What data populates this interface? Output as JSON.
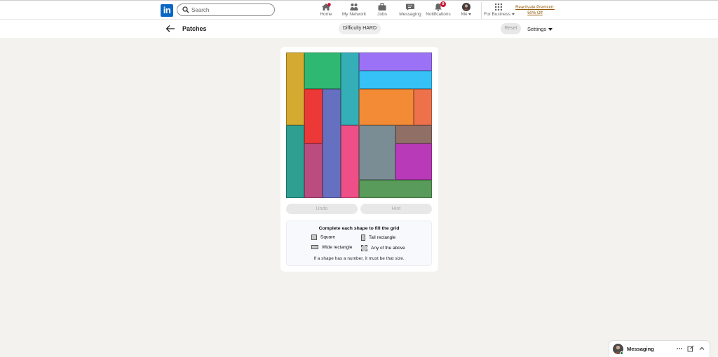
{
  "nav": {
    "logo": "in",
    "search_placeholder": "Search",
    "items": [
      {
        "label": "Home",
        "icon": "home-icon"
      },
      {
        "label": "My Network",
        "icon": "network-icon"
      },
      {
        "label": "Jobs",
        "icon": "jobs-icon"
      },
      {
        "label": "Messaging",
        "icon": "messaging-icon"
      },
      {
        "label": "Notifications",
        "icon": "bell-icon",
        "badge": "8"
      },
      {
        "label": "Me",
        "icon": "avatar"
      },
      {
        "label": "For Business",
        "icon": "grid-icon"
      }
    ],
    "premium_line1": "Reactivate Premium:",
    "premium_line2": "50% Off"
  },
  "game": {
    "title": "Patches",
    "difficulty": "Difficulty HARD",
    "reset": "Reset",
    "settings": "Settings",
    "undo": "Undo",
    "hint": "Hint",
    "grid_size": 8,
    "patches": [
      {
        "name": "patch-mustard",
        "col": 0,
        "row": 0,
        "w": 1,
        "h": 4,
        "color": "#d4aa30"
      },
      {
        "name": "patch-green",
        "col": 1,
        "row": 0,
        "w": 2,
        "h": 2,
        "color": "#2fb872"
      },
      {
        "name": "patch-teal-top",
        "col": 3,
        "row": 0,
        "w": 1,
        "h": 4,
        "color": "#34afb8"
      },
      {
        "name": "patch-purple",
        "col": 4,
        "row": 0,
        "w": 4,
        "h": 1,
        "color": "#9b72f6"
      },
      {
        "name": "patch-sky",
        "col": 4,
        "row": 1,
        "w": 4,
        "h": 1,
        "color": "#36c1f7"
      },
      {
        "name": "patch-red",
        "col": 1,
        "row": 2,
        "w": 1,
        "h": 3,
        "color": "#ed3838"
      },
      {
        "name": "patch-indigo",
        "col": 2,
        "row": 2,
        "w": 1,
        "h": 6,
        "color": "#6570c0"
      },
      {
        "name": "patch-orange",
        "col": 4,
        "row": 2,
        "w": 3,
        "h": 2,
        "color": "#f28a36"
      },
      {
        "name": "patch-coral",
        "col": 7,
        "row": 2,
        "w": 1,
        "h": 2,
        "color": "#ed724c"
      },
      {
        "name": "patch-teal-left",
        "col": 0,
        "row": 4,
        "w": 1,
        "h": 4,
        "color": "#2e9f91"
      },
      {
        "name": "patch-pink",
        "col": 3,
        "row": 4,
        "w": 1,
        "h": 4,
        "color": "#ef4f87"
      },
      {
        "name": "patch-slate",
        "col": 4,
        "row": 4,
        "w": 2,
        "h": 3,
        "color": "#7a8c94"
      },
      {
        "name": "patch-brown",
        "col": 6,
        "row": 4,
        "w": 2,
        "h": 1,
        "color": "#8f6f66"
      },
      {
        "name": "patch-plum",
        "col": 1,
        "row": 5,
        "w": 1,
        "h": 3,
        "color": "#bb4c80"
      },
      {
        "name": "patch-magenta",
        "col": 6,
        "row": 5,
        "w": 2,
        "h": 2,
        "color": "#b93ab8"
      },
      {
        "name": "patch-olive",
        "col": 4,
        "row": 7,
        "w": 4,
        "h": 1,
        "color": "#599b5a"
      }
    ],
    "rules": {
      "title": "Complete each shape to fill the grid",
      "square": "Square",
      "tall": "Tall rectangle",
      "wide": "Wide rectangle",
      "any": "Any of the above",
      "footer": "If a shape has a number, it must be that size."
    }
  },
  "messaging": {
    "label": "Messaging"
  }
}
